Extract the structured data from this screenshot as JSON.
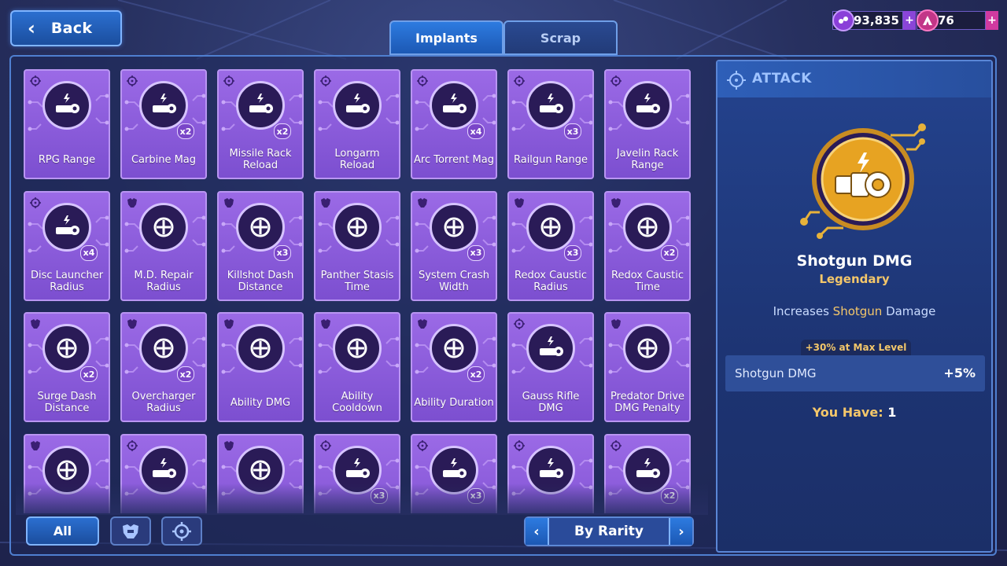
{
  "header": {
    "back_label": "Back"
  },
  "tabs": [
    {
      "label": "Implants",
      "active": true
    },
    {
      "label": "Scrap",
      "active": false
    }
  ],
  "currencies": [
    {
      "icon": "orb-currency-icon",
      "value": "93,835",
      "plus": "+"
    },
    {
      "icon": "a-token-currency-icon",
      "value": "76",
      "plus": "+"
    }
  ],
  "cards": [
    {
      "name": "RPG Range",
      "category": "attack",
      "icon": "rpg-range-icon",
      "mult": ""
    },
    {
      "name": "Carbine Mag",
      "category": "attack",
      "icon": "carbine-mag-icon",
      "mult": "x2"
    },
    {
      "name": "Missile Rack Reload",
      "category": "attack",
      "icon": "missile-rack-reload-icon",
      "mult": "x2"
    },
    {
      "name": "Longarm Reload",
      "category": "attack",
      "icon": "longarm-reload-icon",
      "mult": ""
    },
    {
      "name": "Arc Torrent Mag",
      "category": "attack",
      "icon": "arc-torrent-mag-icon",
      "mult": "x4"
    },
    {
      "name": "Railgun Range",
      "category": "attack",
      "icon": "railgun-range-icon",
      "mult": "x3"
    },
    {
      "name": "Javelin Rack Range",
      "category": "attack",
      "icon": "javelin-rack-range-icon",
      "mult": ""
    },
    {
      "name": "Disc Launcher Radius",
      "category": "attack",
      "icon": "disc-launcher-radius-icon",
      "mult": "x4"
    },
    {
      "name": "M.D. Repair Radius",
      "category": "mech",
      "icon": "md-repair-radius-icon",
      "mult": ""
    },
    {
      "name": "Killshot Dash Distance",
      "category": "mech",
      "icon": "killshot-dash-distance-icon",
      "mult": "x3"
    },
    {
      "name": "Panther Stasis Time",
      "category": "mech",
      "icon": "panther-stasis-time-icon",
      "mult": ""
    },
    {
      "name": "System Crash Width",
      "category": "mech",
      "icon": "system-crash-width-icon",
      "mult": "x3"
    },
    {
      "name": "Redox Caustic Radius",
      "category": "mech",
      "icon": "redox-caustic-radius-icon",
      "mult": "x3"
    },
    {
      "name": "Redox Caustic Time",
      "category": "mech",
      "icon": "redox-caustic-time-icon",
      "mult": "x2"
    },
    {
      "name": "Surge Dash Distance",
      "category": "mech",
      "icon": "surge-dash-distance-icon",
      "mult": "x2"
    },
    {
      "name": "Overcharger Radius",
      "category": "mech",
      "icon": "overcharger-radius-icon",
      "mult": "x2"
    },
    {
      "name": "Ability DMG",
      "category": "mech",
      "icon": "ability-dmg-icon",
      "mult": ""
    },
    {
      "name": "Ability Cooldown",
      "category": "mech",
      "icon": "ability-cooldown-icon",
      "mult": ""
    },
    {
      "name": "Ability Duration",
      "category": "mech",
      "icon": "ability-duration-icon",
      "mult": "x2"
    },
    {
      "name": "Gauss Rifle DMG",
      "category": "attack",
      "icon": "gauss-rifle-dmg-icon",
      "mult": ""
    },
    {
      "name": "Predator Drive DMG Penalty",
      "category": "mech",
      "icon": "predator-drive-dmg-penalty-icon",
      "mult": ""
    },
    {
      "name": "",
      "category": "mech",
      "icon": "mech-ability-icon",
      "mult": ""
    },
    {
      "name": "",
      "category": "attack",
      "icon": "weapon-dmg-icon",
      "mult": ""
    },
    {
      "name": "",
      "category": "mech",
      "icon": "shield-ability-icon",
      "mult": ""
    },
    {
      "name": "",
      "category": "attack",
      "icon": "weapon-dmg-icon",
      "mult": "x3"
    },
    {
      "name": "",
      "category": "attack",
      "icon": "weapon-reload-icon",
      "mult": "x3"
    },
    {
      "name": "",
      "category": "attack",
      "icon": "weapon-dmg-icon",
      "mult": ""
    },
    {
      "name": "",
      "category": "attack",
      "icon": "weapon-dmg-icon",
      "mult": "x2"
    }
  ],
  "filters": {
    "all_label": "All",
    "mech_icon": "mech-filter-icon",
    "attack_icon": "attack-filter-icon"
  },
  "sort": {
    "label": "By Rarity",
    "prev": "‹",
    "next": "›"
  },
  "detail": {
    "category_label": "ATTACK",
    "category_icon": "crosshair-icon",
    "item_icon": "shotgun-dmg-icon",
    "name": "Shotgun DMG",
    "rarity": "Legendary",
    "desc_prefix": "Increases ",
    "desc_highlight": "Shotgun",
    "desc_suffix": " Damage",
    "max_level_note": "+30% at Max Level",
    "stat_label": "Shotgun DMG",
    "stat_value": "+5%",
    "have_label": "You Have:",
    "have_value": "1"
  },
  "colors": {
    "card_purple": "#8f5ee0",
    "accent_blue": "#2d7be0",
    "legendary_gold": "#f4c76a"
  }
}
